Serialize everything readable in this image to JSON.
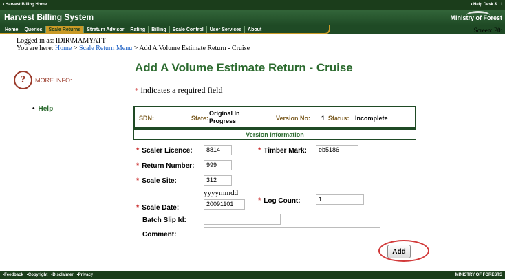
{
  "topbar": {
    "home_link": "• Harvest Billing Home",
    "help_link": "• Help Desk & Li"
  },
  "brand": {
    "title": "Harvest Billing System",
    "ministry": "Ministry of Forest"
  },
  "nav": {
    "items": [
      {
        "label": "Home"
      },
      {
        "label": "Queries"
      },
      {
        "label": "Scale Returns"
      },
      {
        "label": "Stratum Advisor"
      },
      {
        "label": "Rating"
      },
      {
        "label": "Billing"
      },
      {
        "label": "Scale Control"
      },
      {
        "label": "User Services"
      },
      {
        "label": "About"
      }
    ],
    "active_index": 2
  },
  "screen_label": "Screen: P0:",
  "session": {
    "logged_in_as": "Logged in as: IDIR\\MAMYATT"
  },
  "breadcrumb": {
    "prefix": "You are here:",
    "home": "Home",
    "sep1": ">",
    "menu": "Scale Return Menu",
    "sep2": ">",
    "current": "Add A Volume Estimate Return - Cruise"
  },
  "sidebar": {
    "more_info": "MORE INFO:",
    "help": "Help"
  },
  "page_title": "Add A Volume Estimate Return - Cruise",
  "required_note": {
    "marker": "*",
    "text": "indicates a required field"
  },
  "status": {
    "sdn_label": "SDN:",
    "sdn_value": "",
    "state_label": "State:",
    "state_value_line1": "Original In",
    "state_value_line2": "Progress",
    "version_label": "Version No:",
    "version_value": "1",
    "status_label": "Status:",
    "status_value": "Incomplete"
  },
  "version_section": "Version Information",
  "form": {
    "required_marker": "*",
    "scaler_licence": {
      "label": "Scaler Licence:",
      "value": "8814"
    },
    "timber_mark": {
      "label": "Timber Mark:",
      "value": "eb5186"
    },
    "return_number": {
      "label": "Return Number:",
      "value": "999"
    },
    "scale_site": {
      "label": "Scale Site:",
      "value": "312"
    },
    "date_format": "yyyymmdd",
    "scale_date": {
      "label": "Scale Date:",
      "value": "20091101"
    },
    "log_count": {
      "label": "Log Count:",
      "value": "1"
    },
    "batch_slip": {
      "label": "Batch Slip Id:",
      "value": ""
    },
    "comment": {
      "label": "Comment:",
      "value": ""
    },
    "add_button": "Add"
  },
  "footer": {
    "links": [
      "•Feedback",
      "•Copyright",
      "•Disclaimer",
      "•Privacy"
    ],
    "copyright": "MINISTRY OF FORESTS"
  }
}
